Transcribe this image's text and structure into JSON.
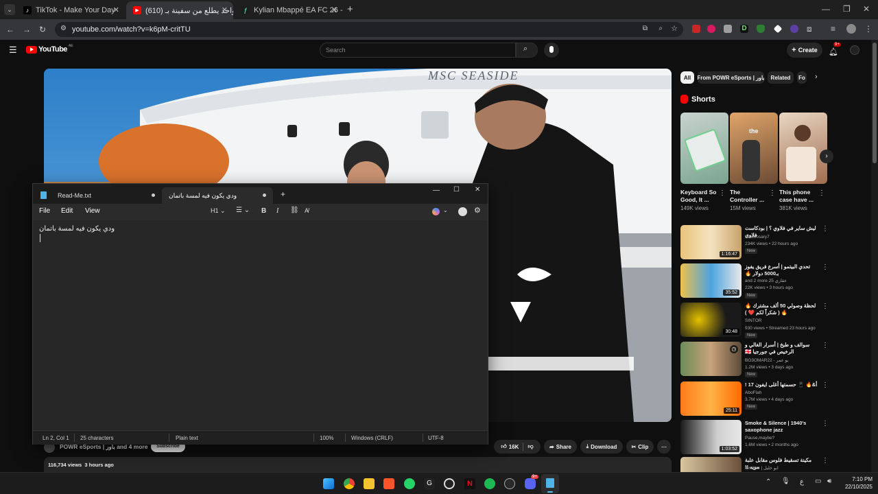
{
  "browser": {
    "tabs": [
      {
        "title": "TikTok - Make Your Day",
        "active": false
      },
      {
        "title": "آخر واحد يطلع من سفينة بـ (610)",
        "active": true
      },
      {
        "title": "Kylian Mbappé EA FC 26 - 91 -",
        "active": false
      }
    ],
    "url": "youtube.com/watch?v=k6pM-critTU",
    "colors": {
      "tabstrip": "#1f1f1f",
      "toolbar": "#35363a"
    }
  },
  "youtube": {
    "logo_text": "YouTube",
    "region": "AE",
    "search_placeholder": "Search",
    "create_label": "Create",
    "notif_badge": "9+",
    "video_text_on_ship": "MSC SEASIDE",
    "chips": [
      "All",
      "From POWR eSports | باور",
      "Related",
      "Fo"
    ],
    "shorts_label": "Shorts",
    "shorts": [
      {
        "title": "Keyboard So Good, It ...",
        "views": "149K views"
      },
      {
        "title": "The Controller ...",
        "views": "15M views"
      },
      {
        "title": "This phone case have ...",
        "views": "381K views"
      }
    ],
    "videos": [
      {
        "title": "ليش ساير في فلاوي ؟ | بودكاست فلاوي",
        "channel": "Madoosary7",
        "meta": "234K views • 22 hours ago",
        "badge": "New",
        "duration": "1:16:47"
      },
      {
        "title": "تحدي البيتمو | أسرع فريق يفوز بـ5000 دولار 🔥",
        "channel": "and 2 more عقاري 25",
        "meta": "22K views • 3 hours ago",
        "badge": "New",
        "duration": "35:52"
      },
      {
        "title": "لحظة وصولي 50 ألف مشترك 🔥🔥 ( شكراً لكم ❤️ )",
        "channel": "SINTOR",
        "meta": "930 views • Streamed 23 hours ago",
        "badge": "New",
        "duration": "30:48"
      },
      {
        "title": "سوالف و طبخ | أسرار الغالي و الرخيص في جورجيا 🇬🇪",
        "channel": "BO3OMAR22 - بو عمر",
        "meta": "1.2M views • 3 days ago",
        "badge": "New",
        "duration": ""
      },
      {
        "title": "أ&🔥 📱 حسمتها أغلى ايفون 17 !",
        "channel": "AboFlah",
        "meta": "3.7M views • 4 days ago",
        "badge": "New",
        "duration": "25:11"
      },
      {
        "title": "Smoke & Silence | 1940's saxophone jazz",
        "channel": "Pause,maybe?",
        "meta": "1.6M views • 2 months ago",
        "badge": "",
        "duration": "1:03:52"
      },
      {
        "title": "مكينة تسقيط فلوس مقابل علبة مويه !!",
        "channel": "Ibrahim | ابو خليل",
        "meta": "",
        "badge": "",
        "duration": ""
      }
    ],
    "channel_name": "POWR eSports | باور and 4 more",
    "subscribe_label": "Subscribe",
    "likes": "16K",
    "share_label": "Share",
    "download_label": "Download",
    "clip_label": "Clip",
    "views_line": "116,734 views  3 hours ago"
  },
  "notepad": {
    "tabs": [
      {
        "title": "Read-Me.txt",
        "active": false
      },
      {
        "title": "ودي يكون فيه لمسة باتمان",
        "active": true
      }
    ],
    "menu": [
      "File",
      "Edit",
      "View"
    ],
    "heading_label": "H1",
    "content": "ودي يكون فيه لمسة باتمان",
    "status": {
      "position": "Ln 2, Col 1",
      "chars": "25 characters",
      "format": "Plain text",
      "zoom": "100%",
      "eol": "Windows (CRLF)",
      "encoding": "UTF-8"
    }
  },
  "taskbar": {
    "lang": "ع",
    "time": "7:10 PM",
    "date": "22/10/2025",
    "discord_badge": "9+"
  }
}
